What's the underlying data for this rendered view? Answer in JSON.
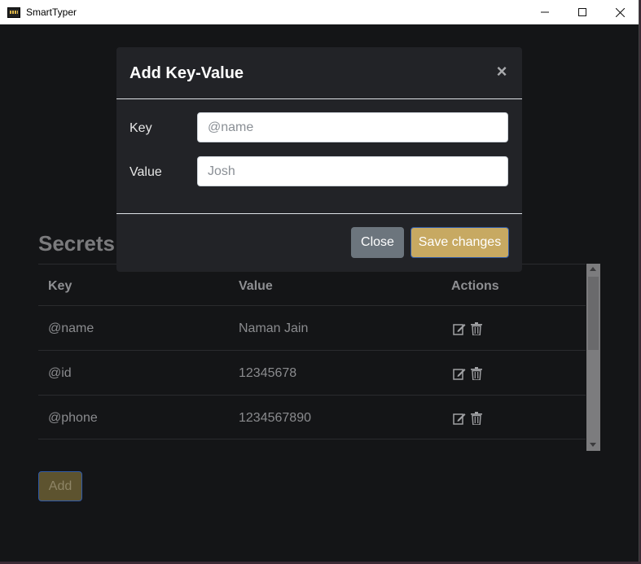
{
  "window": {
    "title": "SmartTyper",
    "minimize_icon": "minimize-icon",
    "maximize_icon": "maximize-icon",
    "close_icon": "close-icon"
  },
  "page": {
    "heading": "Secrets",
    "table": {
      "columns": [
        "Key",
        "Value",
        "Actions"
      ],
      "rows": [
        {
          "key": "@name",
          "value": "Naman Jain"
        },
        {
          "key": "@id",
          "value": "12345678"
        },
        {
          "key": "@phone",
          "value": "1234567890"
        }
      ],
      "row_actions": [
        "edit-icon",
        "trash-icon"
      ]
    },
    "add_button": "Add"
  },
  "modal": {
    "title": "Add Key-Value",
    "close_glyph": "×",
    "fields": {
      "key": {
        "label": "Key",
        "value": "",
        "placeholder": "@name"
      },
      "value": {
        "label": "Value",
        "value": "",
        "placeholder": "Josh"
      }
    },
    "close_button": "Close",
    "save_button": "Save changes"
  },
  "colors": {
    "background": "#141517",
    "modal_background": "#222327",
    "accent": "#c7a962",
    "secondary_button": "#6c757d"
  }
}
